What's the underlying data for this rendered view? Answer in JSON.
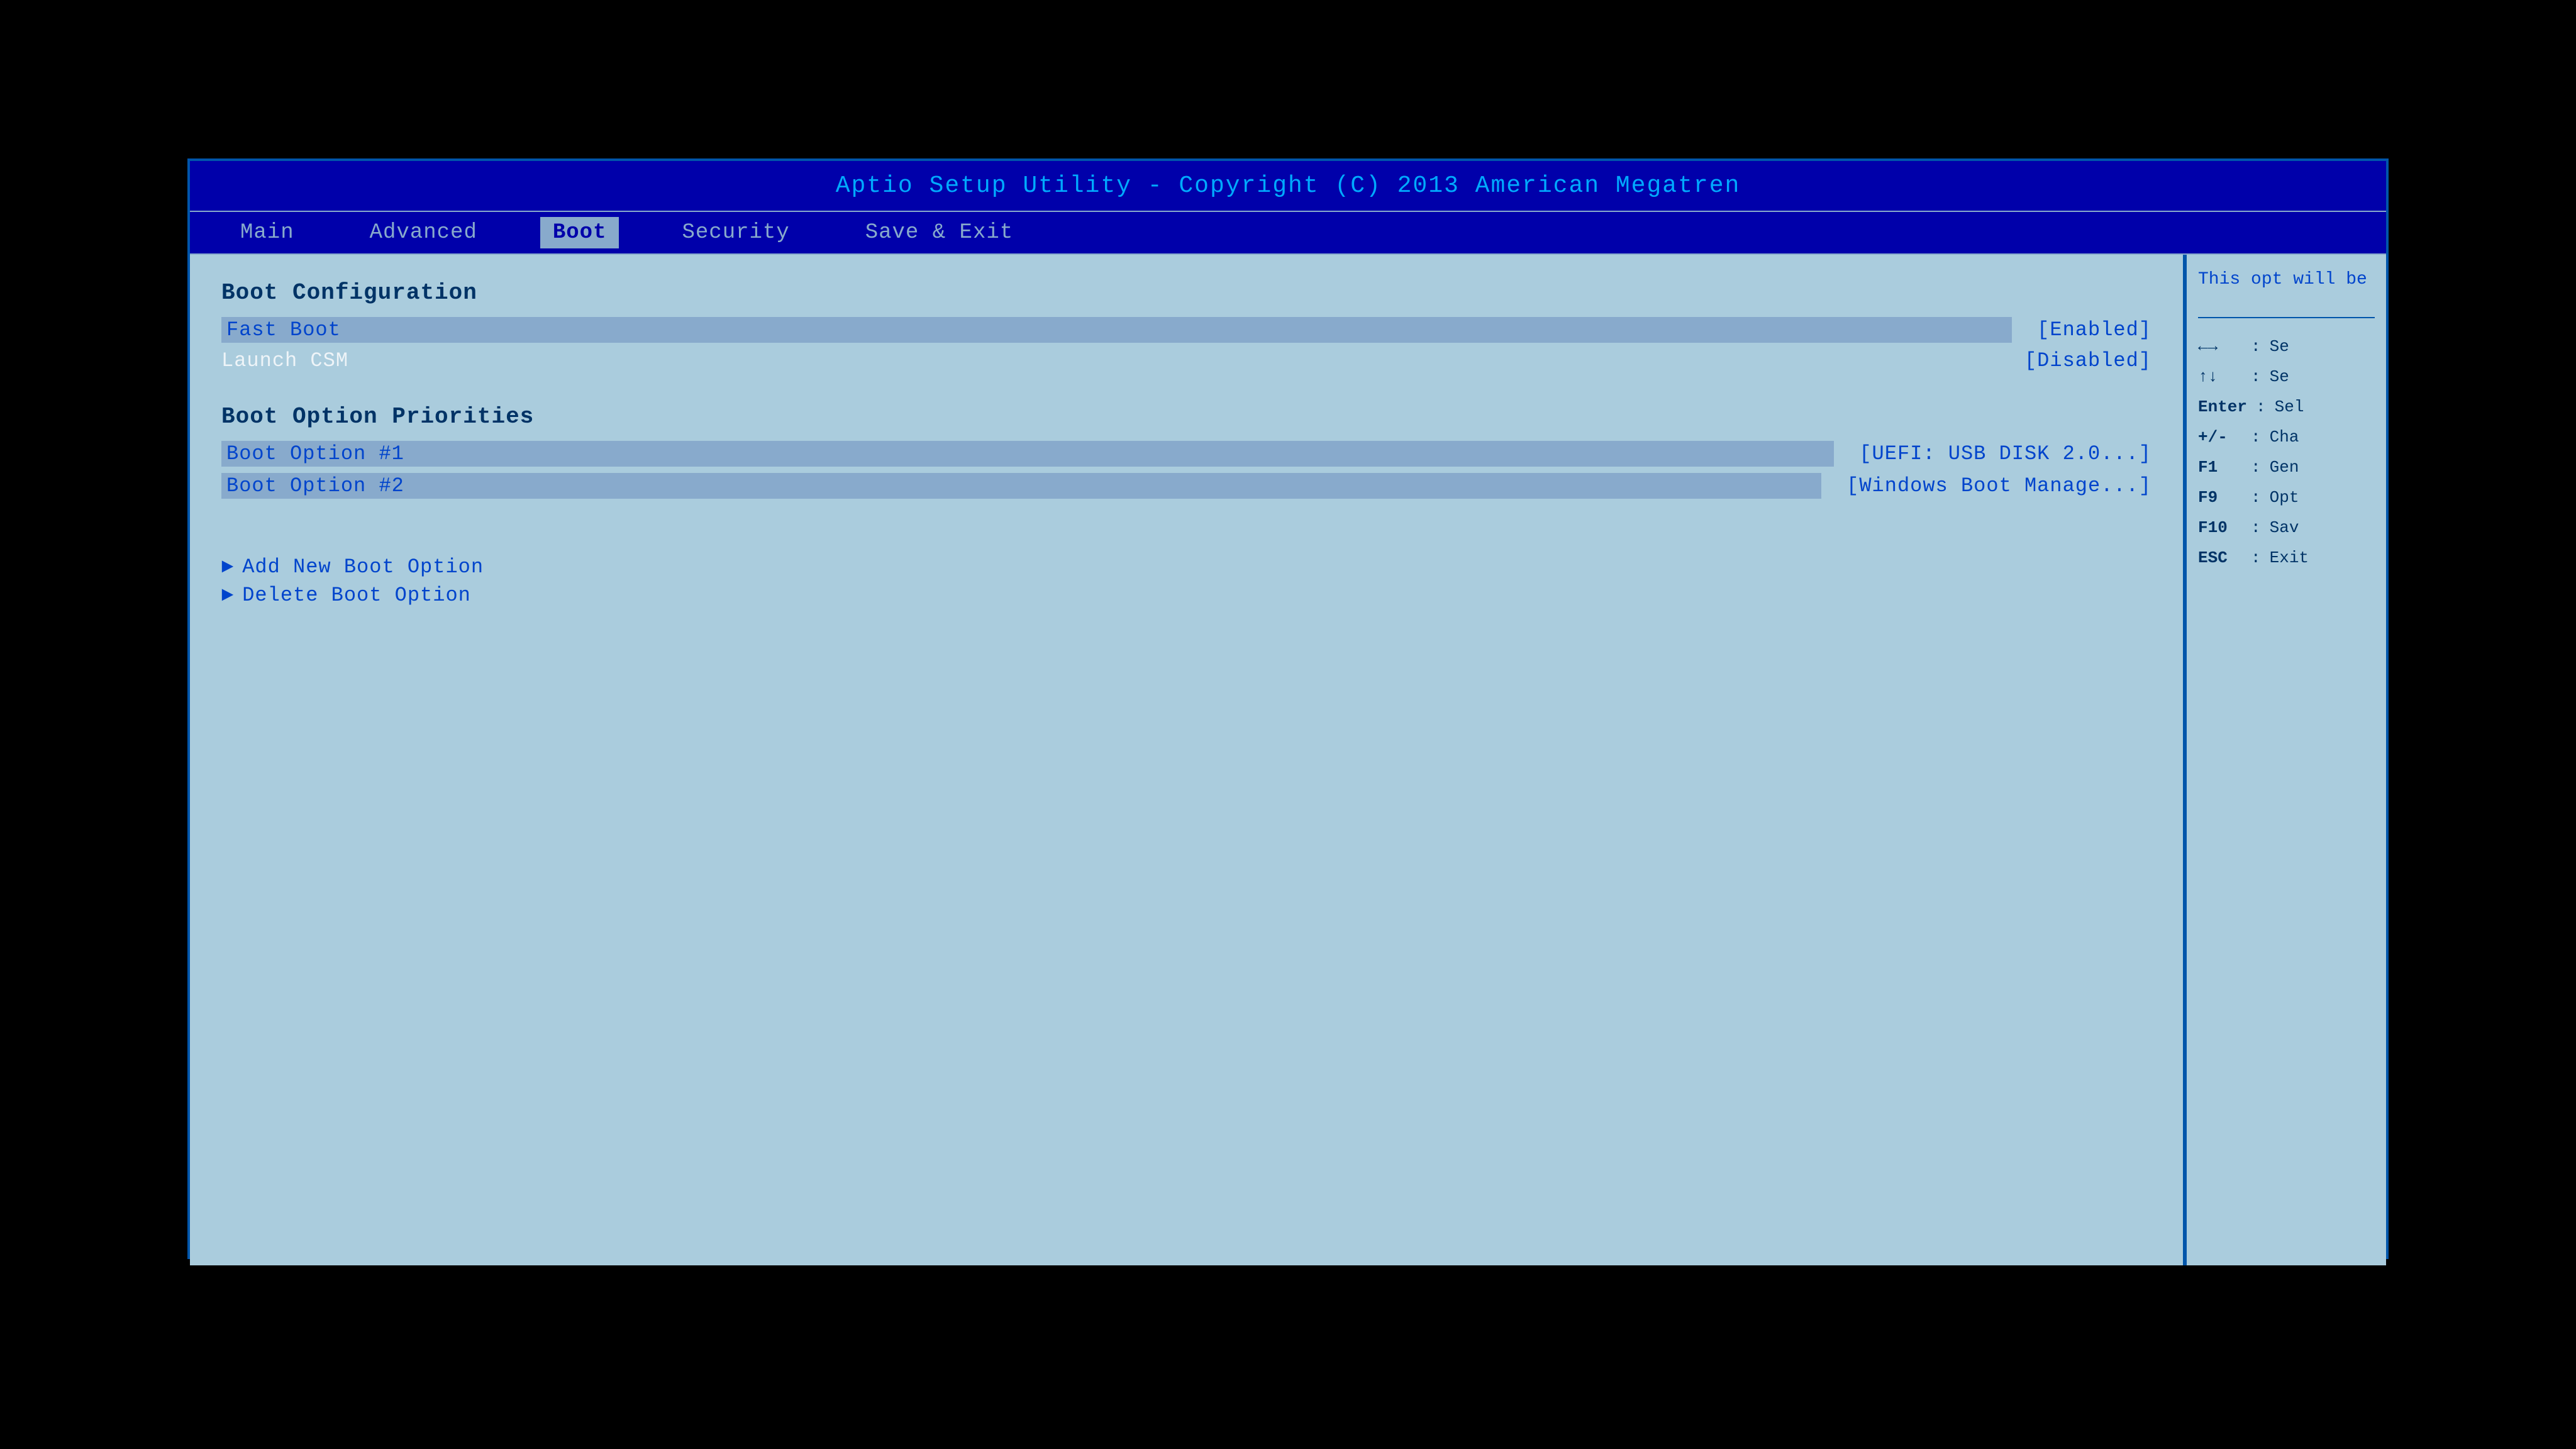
{
  "title_bar": {
    "text": "Aptio Setup Utility - Copyright (C) 2013 American Megatren"
  },
  "nav": {
    "tabs": [
      {
        "id": "main",
        "label": "Main",
        "active": false
      },
      {
        "id": "advanced",
        "label": "Advanced",
        "active": false
      },
      {
        "id": "boot",
        "label": "Boot",
        "active": true
      },
      {
        "id": "security",
        "label": "Security",
        "active": false
      },
      {
        "id": "save_exit",
        "label": "Save & Exit",
        "active": false
      }
    ]
  },
  "main_content": {
    "section1_heading": "Boot Configuration",
    "fast_boot_label": "Fast Boot",
    "fast_boot_value": "[Enabled]",
    "launch_csm_label": "Launch CSM",
    "launch_csm_value": "[Disabled]",
    "section2_heading": "Boot Option Priorities",
    "boot_option1_label": "Boot Option #1",
    "boot_option1_value": "[UEFI:  USB DISK 2.0...]",
    "boot_option2_label": "Boot Option #2",
    "boot_option2_value": "[Windows Boot Manage...]",
    "add_new_boot_label": "Add New Boot Option",
    "delete_boot_label": "Delete Boot Option"
  },
  "right_panel": {
    "help_text": "This opt will be",
    "legend": [
      {
        "key": "←→",
        "sep": ":",
        "desc": "Se"
      },
      {
        "key": "↑↓",
        "sep": ":",
        "desc": "Se"
      },
      {
        "key": "Enter",
        "sep": ":",
        "desc": "Sel"
      },
      {
        "key": "+/-",
        "sep": ":",
        "desc": "Cha"
      },
      {
        "key": "F1",
        "sep": ":",
        "desc": "Gen"
      },
      {
        "key": "F9",
        "sep": ":",
        "desc": "Opt"
      },
      {
        "key": "F10",
        "sep": ":",
        "desc": "Sav"
      },
      {
        "key": "ESC",
        "sep": ":",
        "desc": "Exit"
      }
    ]
  }
}
